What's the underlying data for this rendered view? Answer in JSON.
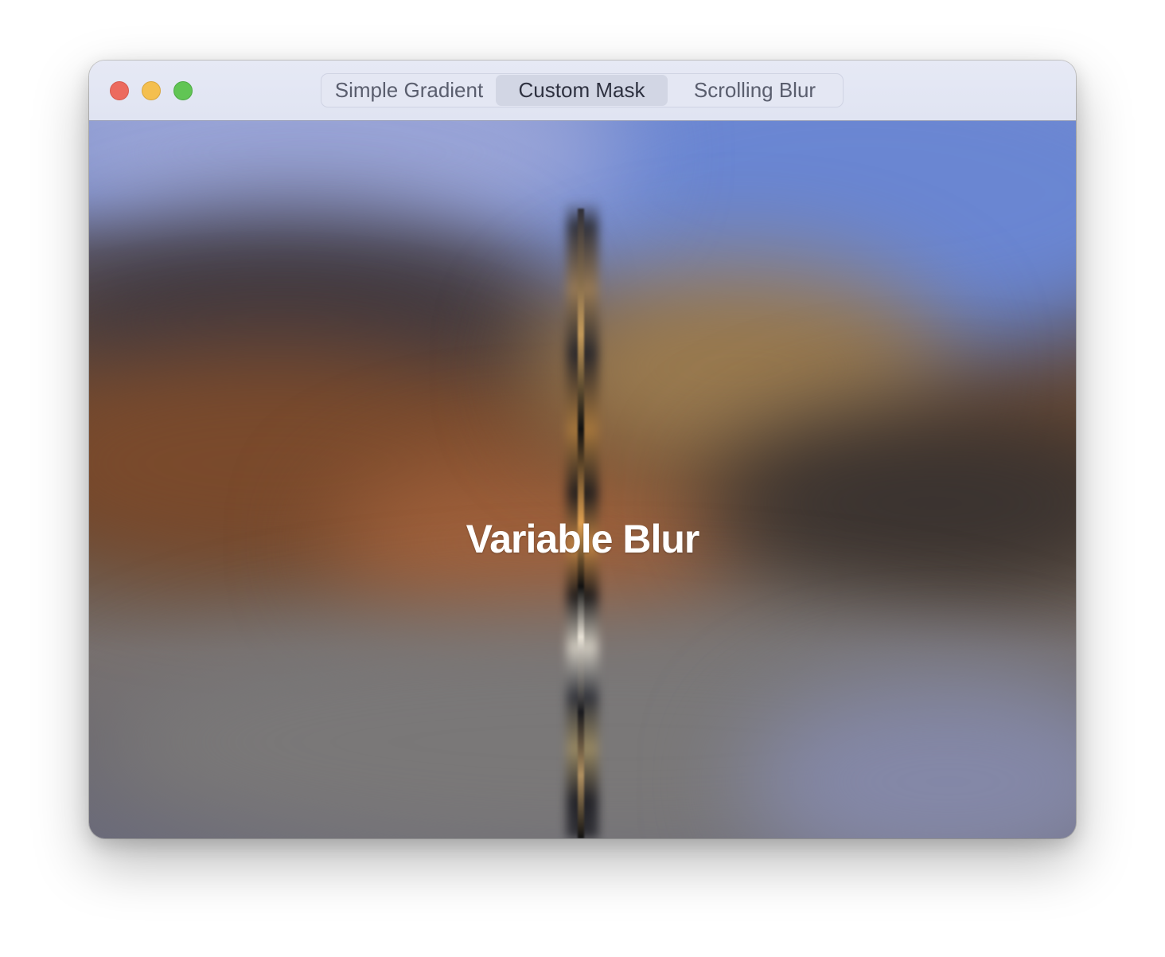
{
  "window": {
    "controls": {
      "close": "close-window",
      "minimize": "minimize-window",
      "zoom": "zoom-window"
    }
  },
  "toolbar": {
    "segments": [
      {
        "label": "Simple Gradient",
        "selected": false
      },
      {
        "label": "Custom Mask",
        "selected": true
      },
      {
        "label": "Scrolling Blur",
        "selected": false
      }
    ]
  },
  "content": {
    "headline": "Variable Blur"
  },
  "colors": {
    "close": "#ec6a5e",
    "minimize": "#f4bf4f",
    "zoom": "#61c554",
    "selected_segment": "#d2d6e4",
    "titlebar": "#e3e6f3"
  }
}
